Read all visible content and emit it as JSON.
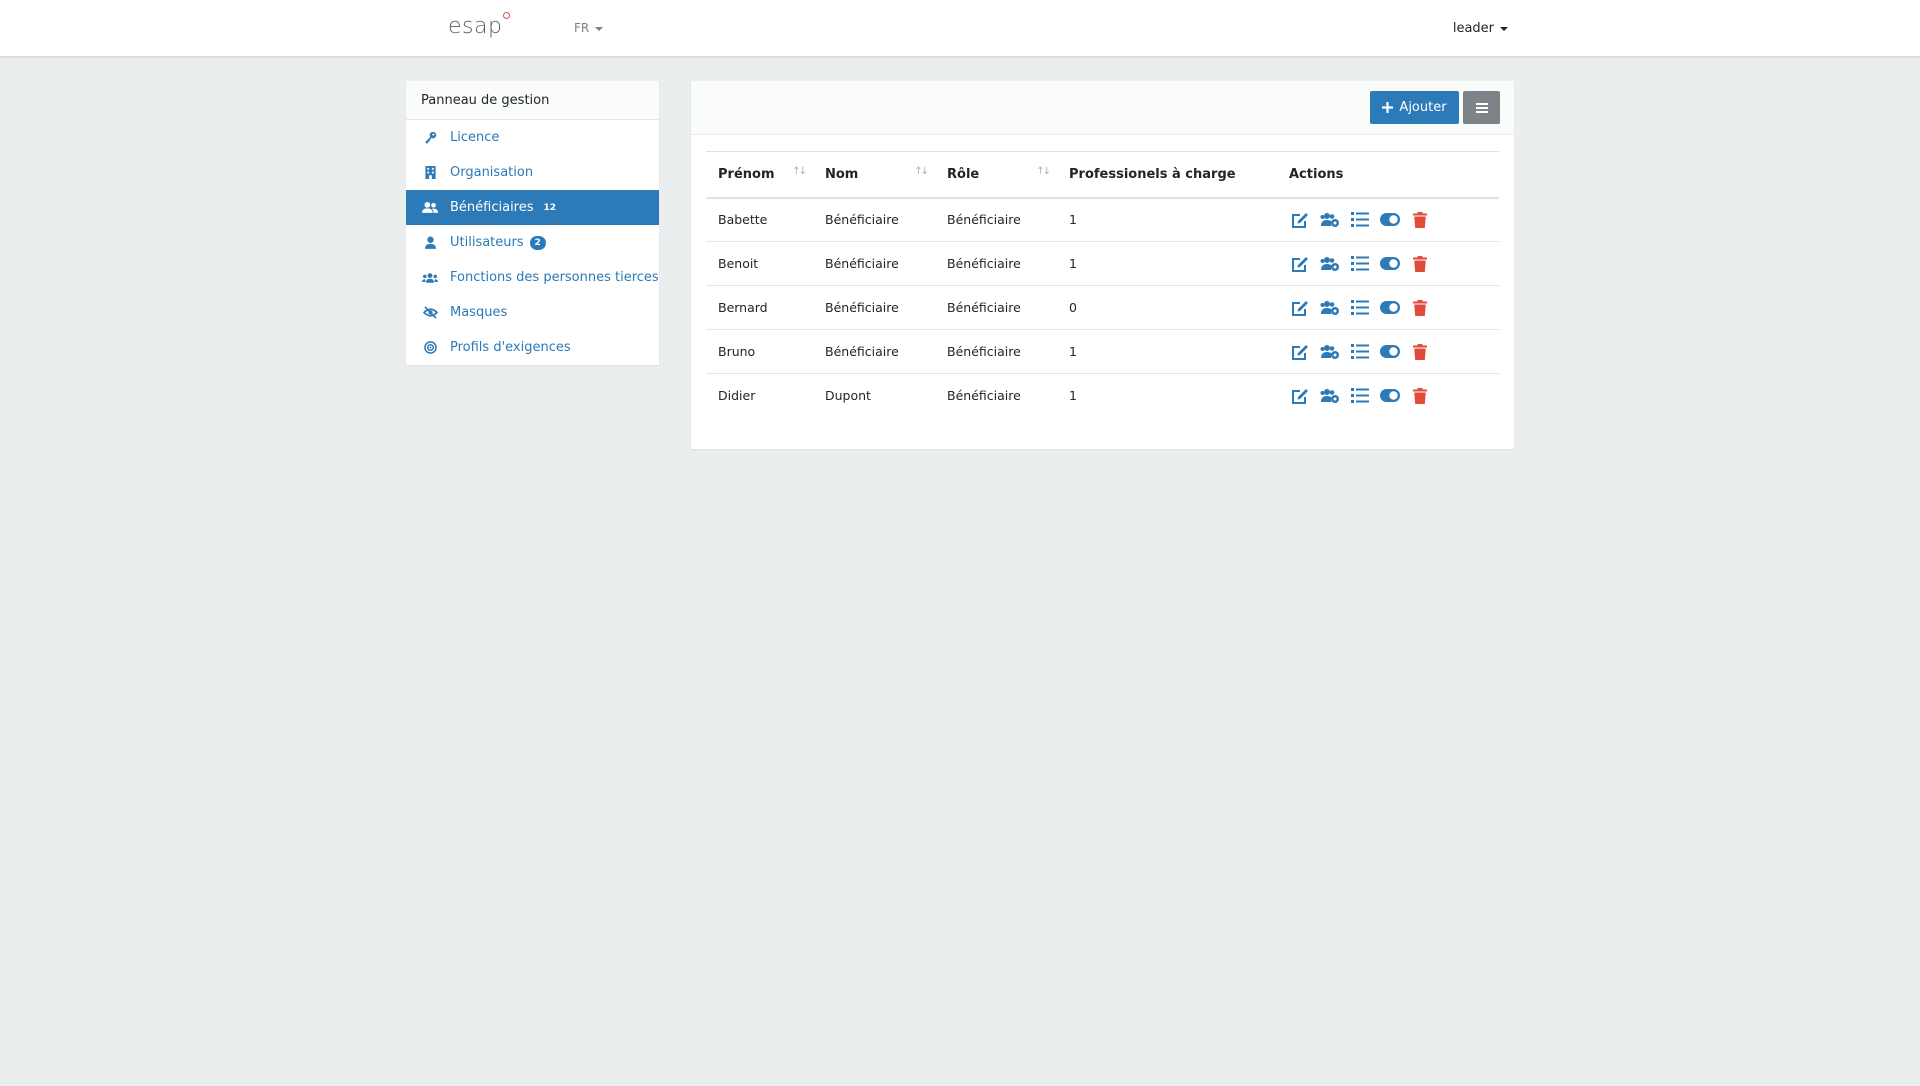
{
  "navbar": {
    "brand": "esap",
    "language": "FR",
    "user": "leader"
  },
  "sidebar": {
    "title": "Panneau de gestion",
    "items": [
      {
        "label": "Licence",
        "icon": "key-icon"
      },
      {
        "label": "Organisation",
        "icon": "building-icon"
      },
      {
        "label": "Bénéficiaires",
        "icon": "user-friends-icon",
        "badge": "12",
        "active": true
      },
      {
        "label": "Utilisateurs",
        "icon": "user-icon",
        "badge": "2"
      },
      {
        "label": "Fonctions des personnes tierces",
        "icon": "users-icon"
      },
      {
        "label": "Masques",
        "icon": "eye-slash-icon"
      },
      {
        "label": "Profils d'exigences",
        "icon": "target-icon"
      }
    ]
  },
  "toolbar": {
    "add_label": "Ajouter"
  },
  "table": {
    "columns": [
      "Prénom",
      "Nom",
      "Rôle",
      "Professionels à charge",
      "Actions"
    ],
    "rows": [
      {
        "prenom": "Babette",
        "nom": "Bénéficiaire",
        "role": "Bénéficiaire",
        "pros": "1"
      },
      {
        "prenom": "Benoit",
        "nom": "Bénéficiaire",
        "role": "Bénéficiaire",
        "pros": "1"
      },
      {
        "prenom": "Bernard",
        "nom": "Bénéficiaire",
        "role": "Bénéficiaire",
        "pros": "0"
      },
      {
        "prenom": "Bruno",
        "nom": "Bénéficiaire",
        "role": "Bénéficiaire",
        "pros": "1"
      },
      {
        "prenom": "Didier",
        "nom": "Dupont",
        "role": "Bénéficiaire",
        "pros": "1"
      }
    ]
  },
  "colors": {
    "primary": "#2c7ab7",
    "danger": "#e04b3a",
    "secondary": "#7d8489",
    "background": "#ebeeef"
  }
}
